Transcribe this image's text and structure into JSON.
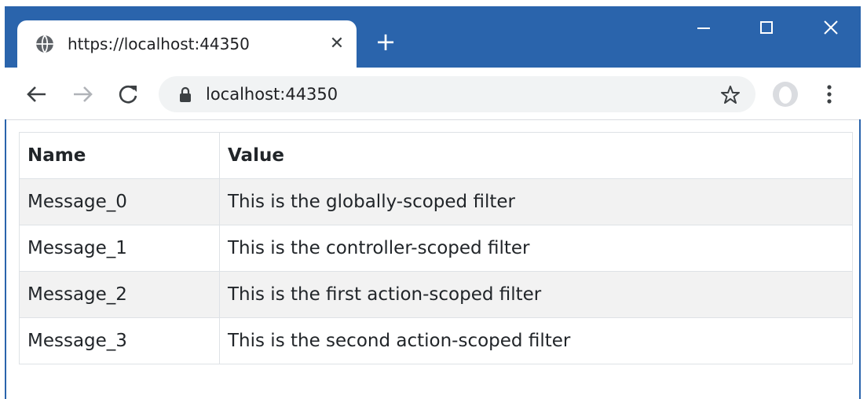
{
  "browser": {
    "tab": {
      "title": "https://localhost:44350",
      "close_glyph": "✕",
      "favicon_icon": "globe-icon"
    },
    "new_tab_glyph": "+",
    "window_controls": {
      "minimize_glyph": "—",
      "maximize_glyph": "☐",
      "close_glyph": "✕"
    },
    "address_bar": {
      "url": "localhost:44350",
      "lock_icon": "lock-icon",
      "bookmark_icon": "star-icon"
    },
    "colors": {
      "frame": "#2a64ac",
      "tab_bg": "#ffffff",
      "omnibox_bg": "#f1f3f4"
    }
  },
  "table": {
    "headers": [
      "Name",
      "Value"
    ],
    "rows": [
      {
        "name": "Message_0",
        "value": "This is the globally-scoped filter"
      },
      {
        "name": "Message_1",
        "value": "This is the controller-scoped filter"
      },
      {
        "name": "Message_2",
        "value": "This is the first action-scoped filter"
      },
      {
        "name": "Message_3",
        "value": "This is the second action-scoped filter"
      }
    ],
    "stripe_color": "#f2f2f2",
    "border_color": "#dee2e6"
  }
}
